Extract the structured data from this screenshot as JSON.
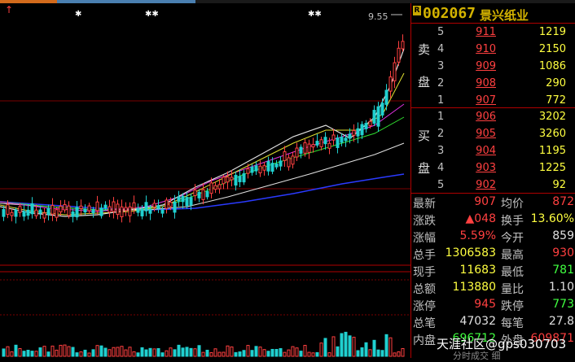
{
  "chart": {
    "high_label": "9.55",
    "up_arrow": "↑",
    "star_marks": [
      "✱",
      "✱✱",
      "✱✱"
    ]
  },
  "header": {
    "badge": "R",
    "code": "002067",
    "name": "景兴纸业"
  },
  "orderbook": {
    "sell_label": [
      "卖",
      "盘"
    ],
    "buy_label": [
      "买",
      "盘"
    ],
    "sell": [
      {
        "level": "5",
        "price": "911",
        "volume": "1219"
      },
      {
        "level": "4",
        "price": "910",
        "volume": "2150"
      },
      {
        "level": "3",
        "price": "909",
        "volume": "1086"
      },
      {
        "level": "2",
        "price": "908",
        "volume": "290"
      },
      {
        "level": "1",
        "price": "907",
        "volume": "772"
      }
    ],
    "buy": [
      {
        "level": "1",
        "price": "906",
        "volume": "3202"
      },
      {
        "level": "2",
        "price": "905",
        "volume": "3260"
      },
      {
        "level": "3",
        "price": "904",
        "volume": "1195"
      },
      {
        "level": "4",
        "price": "903",
        "volume": "1225"
      },
      {
        "level": "5",
        "price": "902",
        "volume": "92"
      }
    ]
  },
  "stats": [
    {
      "k1": "最新",
      "v1": "907",
      "c1": "red",
      "k2": "均价",
      "v2": "872",
      "c2": "red"
    },
    {
      "k1": "涨跌",
      "v1": "▲048",
      "c1": "red",
      "k2": "换手",
      "v2": "13.60%",
      "c2": "yel"
    },
    {
      "k1": "涨幅",
      "v1": "5.59%",
      "c1": "red",
      "k2": "今开",
      "v2": "859",
      "c2": "wht"
    },
    {
      "k1": "总手",
      "v1": "1306583",
      "c1": "yel",
      "k2": "最高",
      "v2": "930",
      "c2": "red"
    },
    {
      "k1": "现手",
      "v1": "11683",
      "c1": "yel",
      "k2": "最低",
      "v2": "781",
      "c2": "grn"
    },
    {
      "k1": "总额",
      "v1": "113880",
      "c1": "yel",
      "k2": "量比",
      "v2": "1.10",
      "c2": "wht"
    },
    {
      "k1": "涨停",
      "v1": "945",
      "c1": "red",
      "k2": "跌停",
      "v2": "773",
      "c2": "grn"
    },
    {
      "k1": "总笔",
      "v1": "47032",
      "c1": "wht",
      "k2": "每笔",
      "v2": "27.8",
      "c2": "wht"
    },
    {
      "k1": "内盘",
      "v1": "696712",
      "c1": "grn",
      "k2": "外盘",
      "v2": "609871",
      "c2": "red"
    }
  ],
  "watermark": "天涯社区@gps030703",
  "footer": "分时成交   细"
}
